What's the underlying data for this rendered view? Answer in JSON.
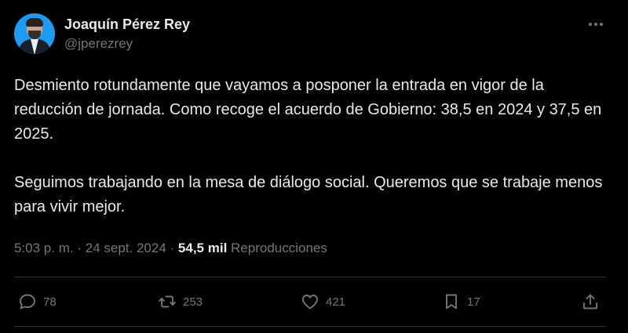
{
  "author": {
    "display_name": "Joaquín Pérez Rey",
    "handle": "@jperezrey",
    "avatar_icon": "avatar-portrait"
  },
  "tweet": {
    "paragraphs": [
      "Desmiento rotundamente que vayamos a posponer la entrada en vigor de la reducción de jornada. Como recoge el acuerdo de Gobierno: 38,5 en 2024 y 37,5 en 2025.",
      "Seguimos trabajando en la mesa de diálogo social. Queremos que se trabaje menos para vivir mejor."
    ],
    "time": "5:03 p. m.",
    "separator": "·",
    "date": "24 sept. 2024",
    "views_count": "54,5 mil",
    "views_label": "Reproducciones"
  },
  "actions": {
    "replies": "78",
    "reposts": "253",
    "likes": "421",
    "bookmarks": "17"
  },
  "colors": {
    "background": "#000000",
    "text": "#e7e9ea",
    "muted": "#71767b",
    "divider": "#2f3336"
  }
}
